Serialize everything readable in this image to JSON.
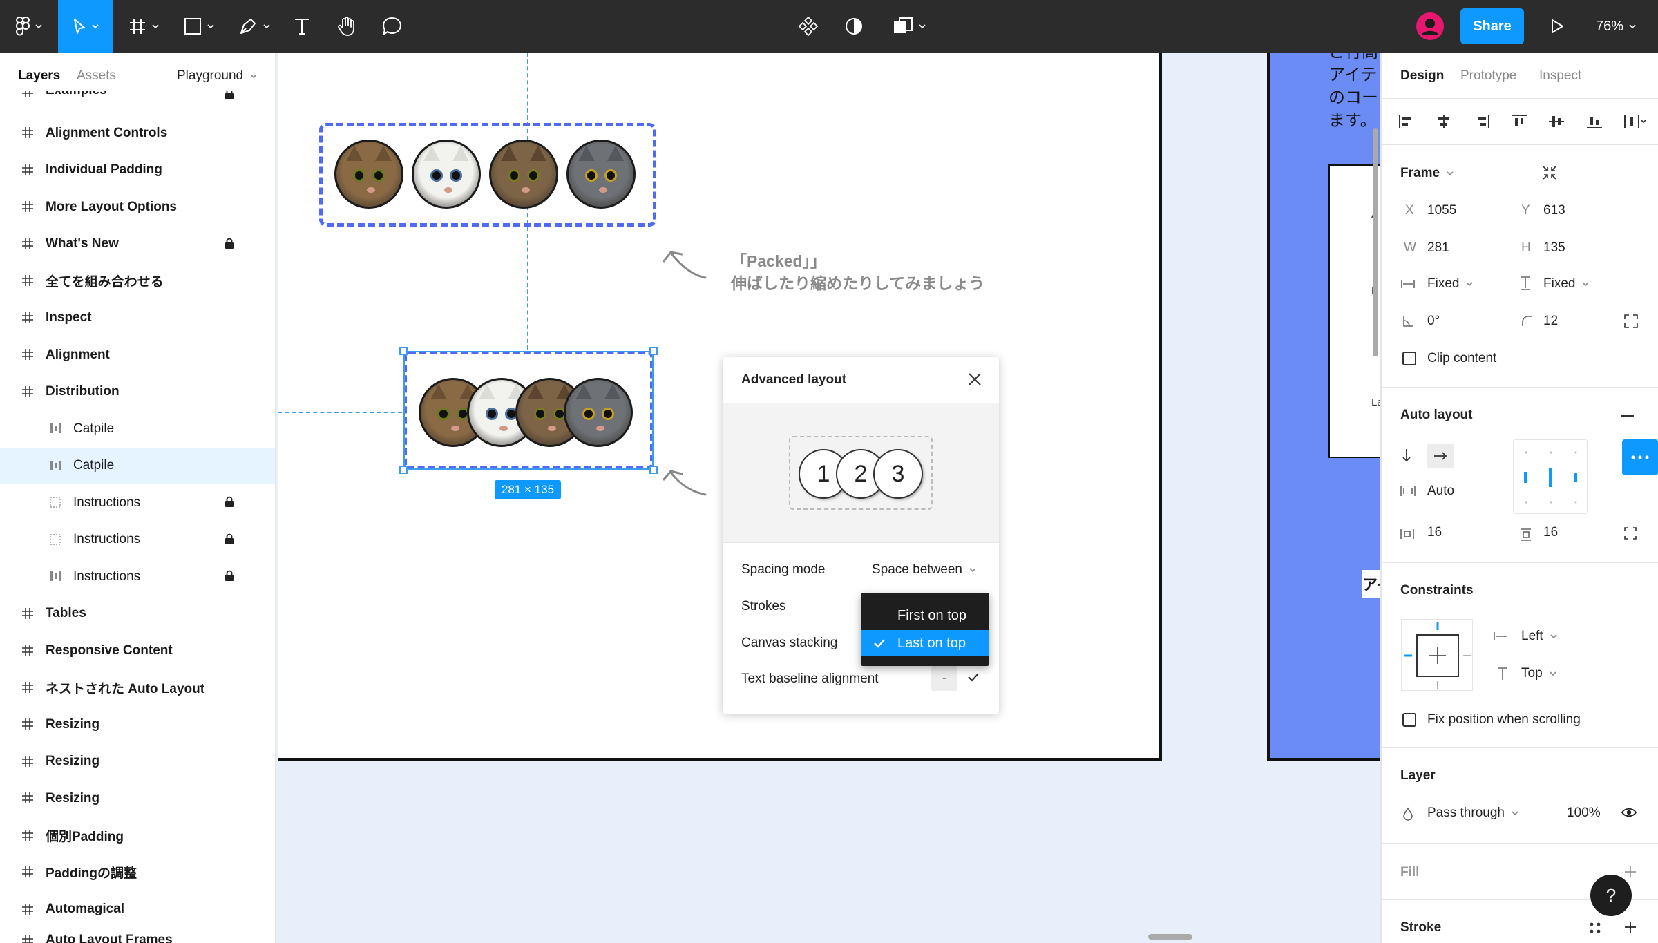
{
  "toolbar": {
    "share_label": "Share",
    "zoom": "76%"
  },
  "left_panel": {
    "tabs": {
      "layers": "Layers",
      "assets": "Assets"
    },
    "page_selector": "Playground",
    "partial_top": "Examples",
    "partial_bottom": "Auto Layout Frames",
    "layers": [
      {
        "label": "Alignment Controls",
        "type": "frame"
      },
      {
        "label": "Individual Padding",
        "type": "frame"
      },
      {
        "label": "More Layout Options",
        "type": "frame"
      },
      {
        "label": "What's New",
        "type": "frame",
        "locked": true
      },
      {
        "label": "全てを組み合わせる",
        "type": "frame"
      },
      {
        "label": "Inspect",
        "type": "frame"
      },
      {
        "label": "Alignment",
        "type": "frame"
      },
      {
        "label": "Distribution",
        "type": "frame"
      },
      {
        "label": "Catpile",
        "type": "autolayout",
        "child": true
      },
      {
        "label": "Catpile",
        "type": "autolayout",
        "child": true,
        "selected": true
      },
      {
        "label": "Instructions",
        "type": "component",
        "child": true,
        "locked": true
      },
      {
        "label": "Instructions",
        "type": "component",
        "child": true,
        "locked": true
      },
      {
        "label": "Instructions",
        "type": "autolayout",
        "child": true,
        "locked": true
      },
      {
        "label": "Tables",
        "type": "frame"
      },
      {
        "label": "Responsive Content",
        "type": "frame"
      },
      {
        "label": "ネストされた Auto Layout",
        "type": "frame"
      },
      {
        "label": "Resizing",
        "type": "frame"
      },
      {
        "label": "Resizing",
        "type": "frame"
      },
      {
        "label": "Resizing",
        "type": "frame"
      },
      {
        "label": "個別Padding",
        "type": "frame"
      },
      {
        "label": "Paddingの調整",
        "type": "frame"
      },
      {
        "label": "Automagical",
        "type": "frame"
      }
    ]
  },
  "canvas": {
    "annotation_line1": "「Packed」」",
    "annotation_line2": "伸ばしたり縮めたりしてみましょう",
    "size_badge": "281 × 135",
    "blue_frame_text": [
      "こ行高",
      "アイテ",
      "のコー",
      "ます。"
    ],
    "blue_frame_bottom": "アイ",
    "side_letters": [
      "A",
      "R",
      "La"
    ]
  },
  "advanced_layout": {
    "title": "Advanced layout",
    "preview_numbers": [
      "1",
      "2",
      "3"
    ],
    "spacing_mode_label": "Spacing mode",
    "spacing_mode_value": "Space between",
    "strokes_label": "Strokes",
    "canvas_stacking_label": "Canvas stacking",
    "text_baseline_label": "Text baseline alignment",
    "baseline_dash": "-",
    "dropdown_options": [
      {
        "label": "First on top",
        "selected": false
      },
      {
        "label": "Last on top",
        "selected": true
      }
    ]
  },
  "right_panel": {
    "tabs": {
      "design": "Design",
      "prototype": "Prototype",
      "inspect": "Inspect"
    },
    "frame": {
      "title": "Frame",
      "x_label": "X",
      "x": "1055",
      "y_label": "Y",
      "y": "613",
      "w_label": "W",
      "w": "281",
      "h_label": "H",
      "h": "135",
      "w_mode": "Fixed",
      "h_mode": "Fixed",
      "rotation": "0°",
      "radius": "12",
      "clip_content": "Clip content"
    },
    "auto_layout": {
      "title": "Auto layout",
      "spacing": "Auto",
      "padding_h": "16",
      "padding_v": "16"
    },
    "constraints": {
      "title": "Constraints",
      "horizontal": "Left",
      "vertical": "Top",
      "fix_position": "Fix position when scrolling"
    },
    "layer": {
      "title": "Layer",
      "blend": "Pass through",
      "opacity": "100%"
    },
    "fill_title": "Fill",
    "stroke_title": "Stroke",
    "help": "?"
  },
  "colors": {
    "accent": "#0d99ff",
    "selection": "#4f6bf5",
    "toolbar": "#2c2c2c"
  }
}
